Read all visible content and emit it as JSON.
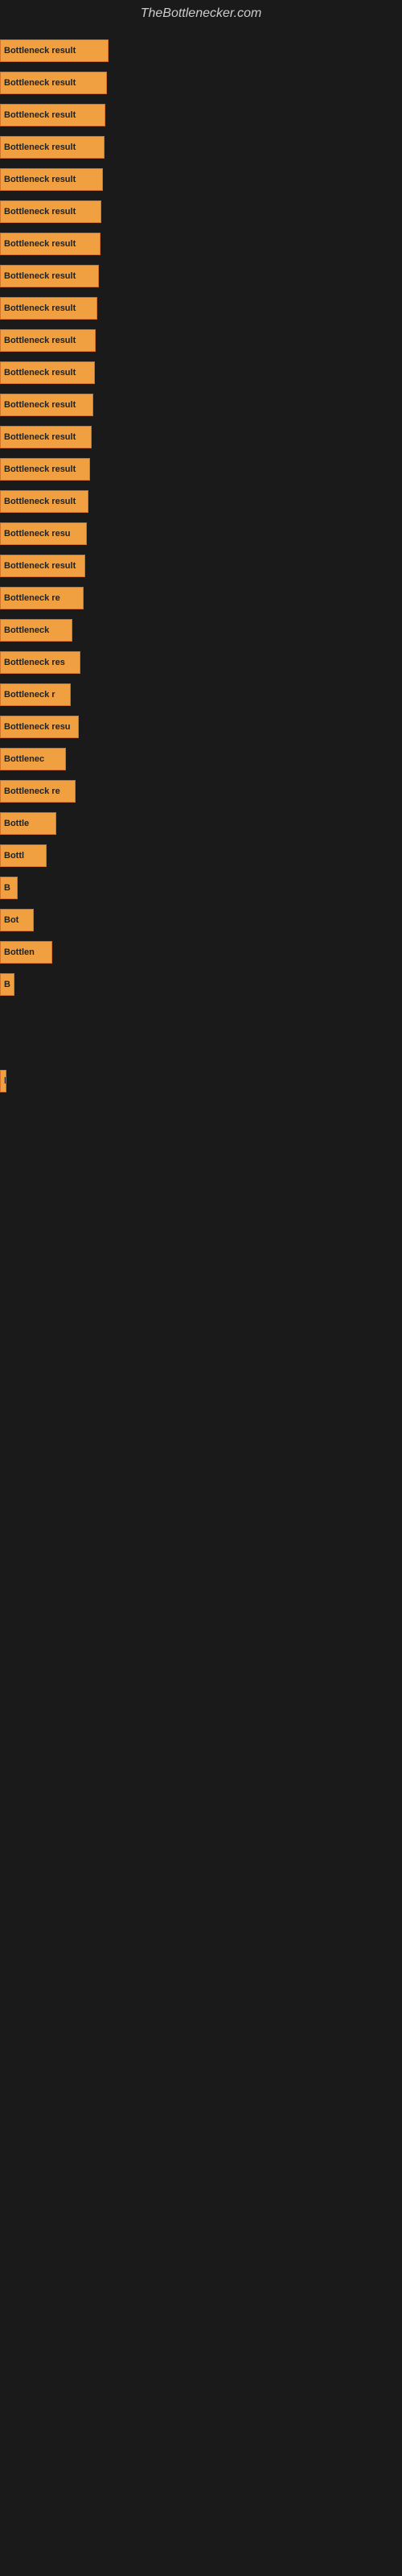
{
  "site": {
    "title": "TheBottlenecker.com"
  },
  "bars": [
    {
      "label": "Bottleneck result",
      "width": 135
    },
    {
      "label": "Bottleneck result",
      "width": 133
    },
    {
      "label": "Bottleneck result",
      "width": 131
    },
    {
      "label": "Bottleneck result",
      "width": 130
    },
    {
      "label": "Bottleneck result",
      "width": 128
    },
    {
      "label": "Bottleneck result",
      "width": 126
    },
    {
      "label": "Bottleneck result",
      "width": 125
    },
    {
      "label": "Bottleneck result",
      "width": 123
    },
    {
      "label": "Bottleneck result",
      "width": 121
    },
    {
      "label": "Bottleneck result",
      "width": 119
    },
    {
      "label": "Bottleneck result",
      "width": 118
    },
    {
      "label": "Bottleneck result",
      "width": 116
    },
    {
      "label": "Bottleneck result",
      "width": 114
    },
    {
      "label": "Bottleneck result",
      "width": 112
    },
    {
      "label": "Bottleneck result",
      "width": 110
    },
    {
      "label": "Bottleneck resu",
      "width": 108
    },
    {
      "label": "Bottleneck result",
      "width": 106
    },
    {
      "label": "Bottleneck re",
      "width": 104
    },
    {
      "label": "Bottleneck",
      "width": 90
    },
    {
      "label": "Bottleneck res",
      "width": 100
    },
    {
      "label": "Bottleneck r",
      "width": 88
    },
    {
      "label": "Bottleneck resu",
      "width": 98
    },
    {
      "label": "Bottlenec",
      "width": 82
    },
    {
      "label": "Bottleneck re",
      "width": 94
    },
    {
      "label": "Bottle",
      "width": 70
    },
    {
      "label": "Bottl",
      "width": 58
    },
    {
      "label": "B",
      "width": 22
    },
    {
      "label": "Bot",
      "width": 42
    },
    {
      "label": "Bottlen",
      "width": 65
    },
    {
      "label": "B",
      "width": 18
    },
    {
      "label": "",
      "width": 0
    },
    {
      "label": "",
      "width": 0
    },
    {
      "label": "l",
      "width": 8
    },
    {
      "label": "",
      "width": 0
    },
    {
      "label": "",
      "width": 0
    },
    {
      "label": "",
      "width": 0
    }
  ]
}
